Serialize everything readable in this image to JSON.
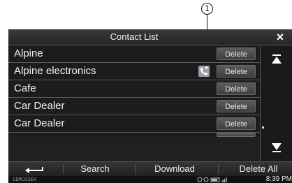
{
  "callout": {
    "number": "1"
  },
  "window": {
    "title": "Contact List",
    "close_glyph": "×"
  },
  "contacts": [
    {
      "name": "Alpine",
      "delete_label": "Delete"
    },
    {
      "name": "Alpine electronics",
      "delete_label": "Delete",
      "icon": "phone-sync-icon"
    },
    {
      "name": "Cafe",
      "delete_label": "Delete"
    },
    {
      "name": "Car Dealer",
      "delete_label": "Delete"
    },
    {
      "name": "Car Dealer",
      "delete_label": "Delete"
    }
  ],
  "toolbar": {
    "back_icon": "return-arrow-icon",
    "search_label": "Search",
    "download_label": "Download",
    "delete_all_label": "Delete All"
  },
  "status": {
    "code": "SEMC03EH",
    "time": "8:39 PM",
    "icons": "bluetooth-signal-battery"
  }
}
